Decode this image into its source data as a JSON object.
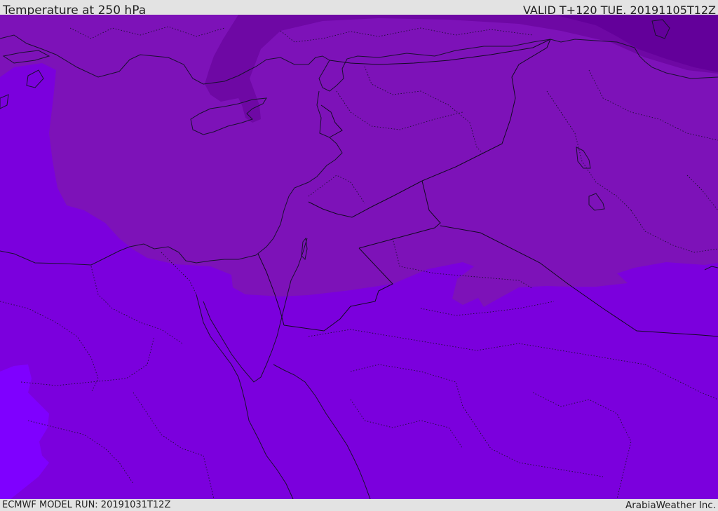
{
  "header": {
    "title": "Temperature at 250 hPa",
    "valid": "VALID T+120 TUE. 20191105T12Z"
  },
  "footer": {
    "model_run": "ECMWF MODEL RUN: 20191031T12Z",
    "credit": "ArabiaWeather Inc."
  },
  "map": {
    "colors": {
      "base": "#7b00dd",
      "mid": "#7d12b8",
      "dark": "#6e08a4",
      "darkest": "#63009a",
      "warm": "#7f00ff"
    }
  }
}
